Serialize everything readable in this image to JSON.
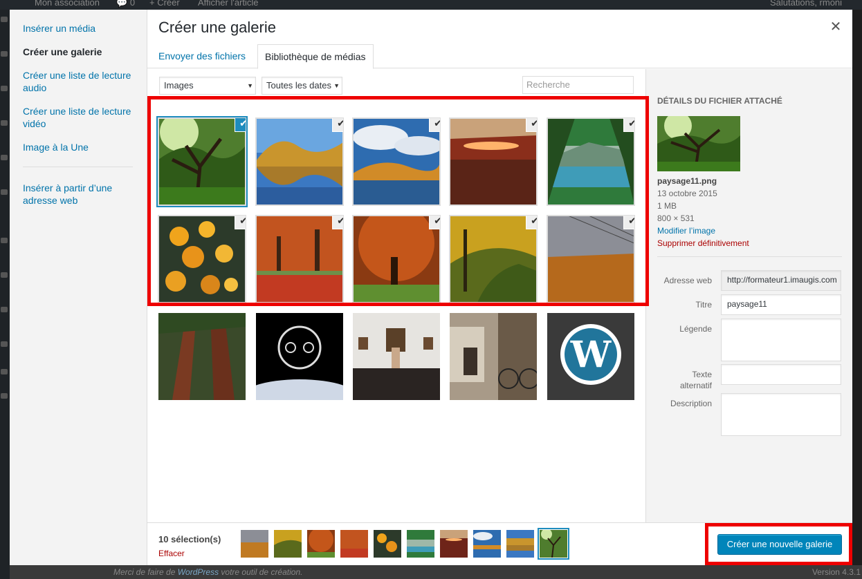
{
  "colors": {
    "accent": "#0073aa",
    "button": "#0085ba",
    "selection": "#1e8cbe",
    "danger": "#a00",
    "highlight": "#ee0000"
  },
  "admin_bar": {
    "site_name": "Mon association",
    "comments": "0",
    "new": "Créer",
    "view": "Afficher l'article",
    "greeting": "Salutations, rmoni"
  },
  "wp_footer": {
    "thanks_prefix": "Merci de faire de ",
    "thanks_link": "WordPress",
    "thanks_suffix": " votre outil de création.",
    "version": "Version 4.3.1"
  },
  "menu": {
    "items": [
      {
        "label": "Insérer un média"
      },
      {
        "label": "Créer une galerie"
      },
      {
        "label": "Créer une liste de lecture audio"
      },
      {
        "label": "Créer une liste de lecture vidéo"
      },
      {
        "label": "Image à la Une"
      },
      {
        "label": "Insérer à partir d’une adresse web"
      }
    ]
  },
  "frame": {
    "title": "Créer une galerie",
    "close_icon": "close-icon"
  },
  "tabs": [
    {
      "label": "Envoyer des fichiers"
    },
    {
      "label": "Bibliothèque de médias"
    }
  ],
  "toolbar": {
    "type_filter": "Images",
    "date_filter": "Toutes les dates",
    "search_placeholder": "Recherche"
  },
  "grid": {
    "items": [
      {
        "name": "tree-forest",
        "selected": true,
        "focused": true
      },
      {
        "name": "autumn-lake",
        "selected": true
      },
      {
        "name": "lake-clouds",
        "selected": true
      },
      {
        "name": "rock-arch",
        "selected": true
      },
      {
        "name": "mountain-lake",
        "selected": true
      },
      {
        "name": "yellow-leaves",
        "selected": true
      },
      {
        "name": "red-park",
        "selected": true
      },
      {
        "name": "orange-tree",
        "selected": true
      },
      {
        "name": "golden-forest",
        "selected": true
      },
      {
        "name": "wheat-field",
        "selected": true
      },
      {
        "name": "sequoias",
        "selected": false
      },
      {
        "name": "space-face",
        "selected": false
      },
      {
        "name": "museum",
        "selected": false
      },
      {
        "name": "bicycle-street",
        "selected": false
      },
      {
        "name": "wordpress-logo",
        "selected": false
      }
    ]
  },
  "details": {
    "heading": "Détails du fichier attaché",
    "filename": "paysage11.png",
    "date": "13 octobre 2015",
    "size": "1 MB",
    "dimensions": "800 × 531",
    "edit_link": "Modifier l’image",
    "delete_link": "Supprimer définitivement",
    "fields": {
      "url_label": "Adresse web",
      "url_value": "http://formateur1.imaugis.com",
      "title_label": "Titre",
      "title_value": "paysage11",
      "caption_label": "Légende",
      "caption_value": "",
      "alt_label_1": "Texte",
      "alt_label_2": "alternatif",
      "alt_value": "",
      "description_label": "Description",
      "description_value": ""
    }
  },
  "footer": {
    "count": "10 sélection(s)",
    "clear": "Effacer",
    "button": "Créer une nouvelle galerie"
  }
}
